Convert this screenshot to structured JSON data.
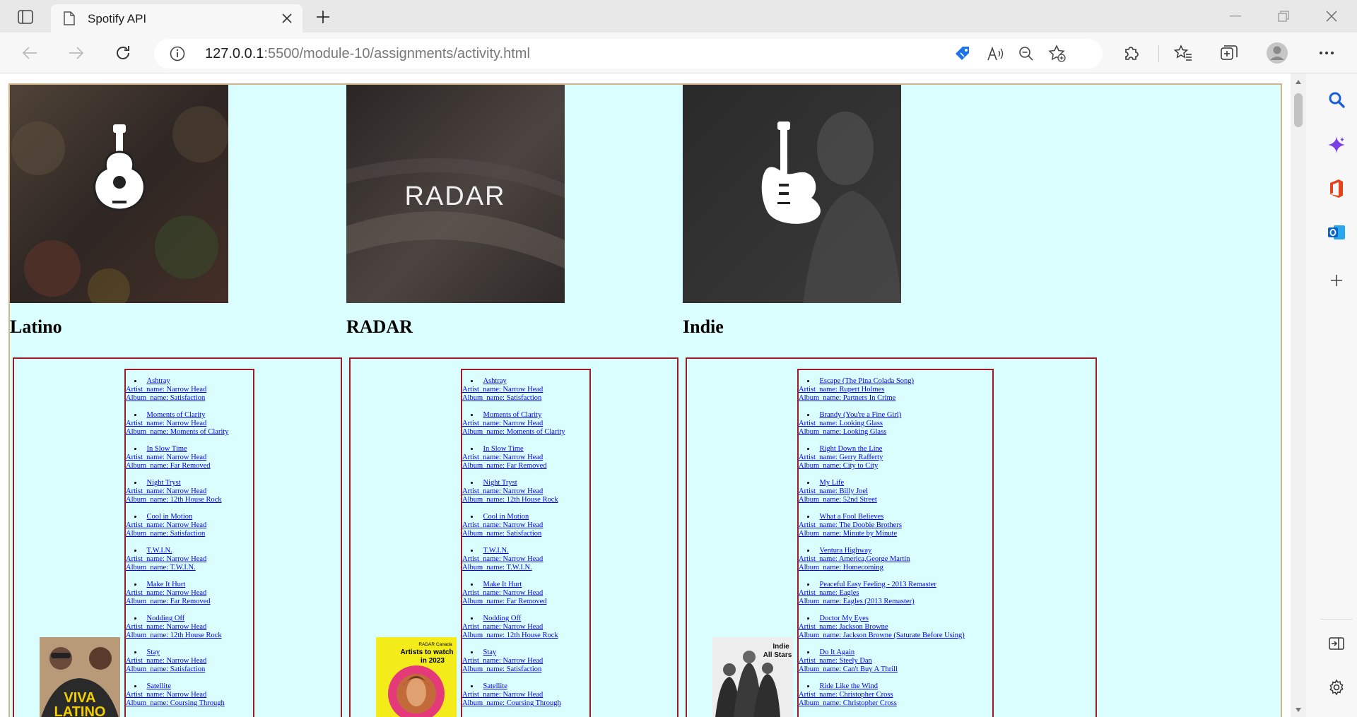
{
  "browser": {
    "tab_title": "Spotify API",
    "url_host": "127.0.0.1",
    "url_rest": ":5500/module-10/assignments/activity.html"
  },
  "categories": [
    {
      "name": "Latino",
      "playlist_cover_text": "VIVA LATINO",
      "tracks": [
        {
          "name": "Ashtray",
          "artist": "Artist_name: Narrow Head",
          "album": "Album_name: Satisfaction"
        },
        {
          "name": "Moments of Clarity",
          "artist": "Artist_name: Narrow Head",
          "album": "Album_name: Moments of Clarity"
        },
        {
          "name": "In Slow Time",
          "artist": "Artist_name: Narrow Head",
          "album": "Album_name: Far Removed"
        },
        {
          "name": "Night Tryst",
          "artist": "Artist_name: Narrow Head",
          "album": "Album_name: 12th House Rock"
        },
        {
          "name": "Cool in Motion",
          "artist": "Artist_name: Narrow Head",
          "album": "Album_name: Satisfaction"
        },
        {
          "name": "T.W.I.N.",
          "artist": "Artist_name: Narrow Head",
          "album": "Album_name: T.W.I.N."
        },
        {
          "name": "Make It Hurt",
          "artist": "Artist_name: Narrow Head",
          "album": "Album_name: Far Removed"
        },
        {
          "name": "Nodding Off",
          "artist": "Artist_name: Narrow Head",
          "album": "Album_name: 12th House Rock"
        },
        {
          "name": "Stay",
          "artist": "Artist_name: Narrow Head",
          "album": "Album_name: Satisfaction"
        },
        {
          "name": "Satellite",
          "artist": "Artist_name: Narrow Head",
          "album": "Album_name: Coursing Through"
        }
      ]
    },
    {
      "name": "RADAR",
      "cover_text": "RADAR",
      "playlist_cover_text": "RADAR Canada Artists to watch in 2023",
      "tracks": [
        {
          "name": "Ashtray",
          "artist": "Artist_name: Narrow Head",
          "album": "Album_name: Satisfaction"
        },
        {
          "name": "Moments of Clarity",
          "artist": "Artist_name: Narrow Head",
          "album": "Album_name: Moments of Clarity"
        },
        {
          "name": "In Slow Time",
          "artist": "Artist_name: Narrow Head",
          "album": "Album_name: Far Removed"
        },
        {
          "name": "Night Tryst",
          "artist": "Artist_name: Narrow Head",
          "album": "Album_name: 12th House Rock"
        },
        {
          "name": "Cool in Motion",
          "artist": "Artist_name: Narrow Head",
          "album": "Album_name: Satisfaction"
        },
        {
          "name": "T.W.I.N.",
          "artist": "Artist_name: Narrow Head",
          "album": "Album_name: T.W.I.N."
        },
        {
          "name": "Make It Hurt",
          "artist": "Artist_name: Narrow Head",
          "album": "Album_name: Far Removed"
        },
        {
          "name": "Nodding Off",
          "artist": "Artist_name: Narrow Head",
          "album": "Album_name: 12th House Rock"
        },
        {
          "name": "Stay",
          "artist": "Artist_name: Narrow Head",
          "album": "Album_name: Satisfaction"
        },
        {
          "name": "Satellite",
          "artist": "Artist_name: Narrow Head",
          "album": "Album_name: Coursing Through"
        }
      ]
    },
    {
      "name": "Indie",
      "playlist_cover_text": "Indie All Stars",
      "tracks": [
        {
          "name": "Escape (The Pina Colada Song)",
          "artist": "Artist_name: Rupert Holmes",
          "album": "Album_name: Partners In Crime"
        },
        {
          "name": "Brandy (You're a Fine Girl)",
          "artist": "Artist_name: Looking Glass",
          "album": "Album_name: Looking Glass"
        },
        {
          "name": "Right Down the Line",
          "artist": "Artist_name: Gerry Rafferty",
          "album": "Album_name: City to City"
        },
        {
          "name": "My Life",
          "artist": "Artist_name: Billy Joel",
          "album": "Album_name: 52nd Street"
        },
        {
          "name": "What a Fool Believes",
          "artist": "Artist_name: The Doobie Brothers",
          "album": "Album_name: Minute by Minute"
        },
        {
          "name": "Ventura Highway",
          "artist": "Artist_name: America,George Martin",
          "album": "Album_name: Homecoming"
        },
        {
          "name": "Peaceful Easy Feeling - 2013 Remaster",
          "artist": "Artist_name: Eagles",
          "album": "Album_name: Eagles (2013 Remaster)"
        },
        {
          "name": "Doctor My Eyes",
          "artist": "Artist_name: Jackson Browne",
          "album": "Album_name: Jackson Browne (Saturate Before Using)"
        },
        {
          "name": "Do It Again",
          "artist": "Artist_name: Steely Dan",
          "album": "Album_name: Can't Buy A Thrill"
        },
        {
          "name": "Ride Like the Wind",
          "artist": "Artist_name: Christopher Cross",
          "album": "Album_name: Christopher Cross"
        }
      ]
    }
  ],
  "colors": {
    "page_bg": "#dafefd",
    "box_border": "#9b1d2a",
    "link": "#0000ee"
  }
}
